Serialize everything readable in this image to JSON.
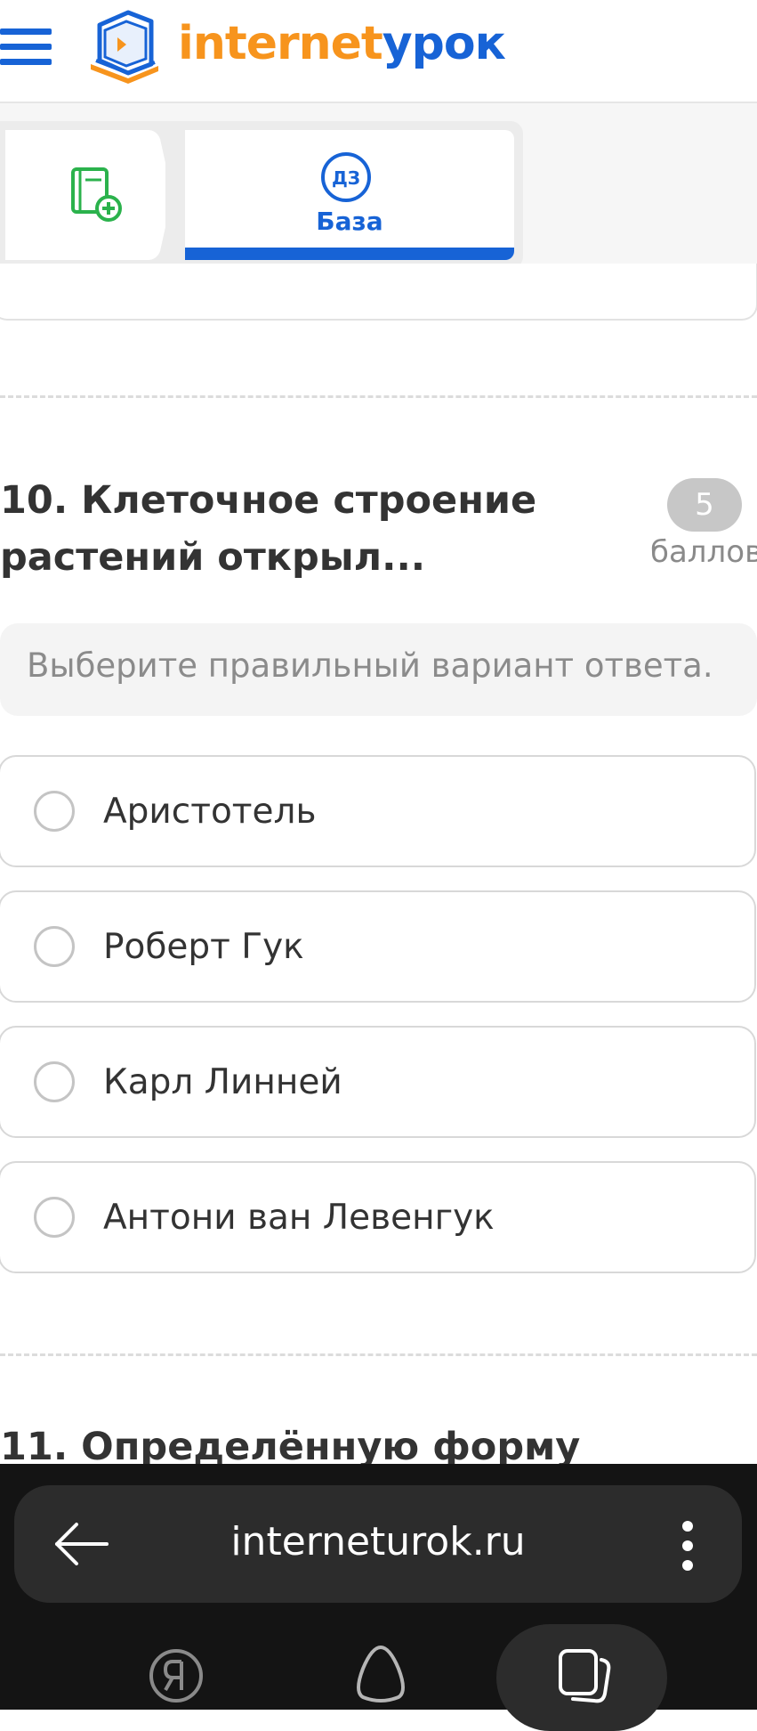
{
  "header": {
    "logo_part1": "internet",
    "logo_part2": "урок",
    "menu_icon": "hamburger-menu-icon",
    "logo_icon": "book-logo-icon"
  },
  "tabs": {
    "first_icon": "add-book-icon",
    "second_icon_text": "ДЗ",
    "second_label": "База"
  },
  "question": {
    "title_line1": "10. Клеточное строение",
    "title_line2": "растений открыл...",
    "points": "5",
    "points_label": "баллов",
    "hint": "Выберите правильный вариант ответа.",
    "options": [
      {
        "label": "Аристотель"
      },
      {
        "label": "Роберт Гук"
      },
      {
        "label": "Карл Линней"
      },
      {
        "label": "Антони ван Левенгук"
      }
    ]
  },
  "next_question": {
    "title": "11. Определённую форму"
  },
  "browser": {
    "url": "interneturok.ru",
    "back_icon": "back-arrow-icon",
    "menu_icon": "kebab-menu-icon",
    "nav": [
      "yandex-icon",
      "alice-icon",
      "tabs-icon"
    ]
  },
  "colors": {
    "brand_blue": "#1763d6",
    "brand_orange": "#f7941d",
    "green": "#2bb24c"
  }
}
